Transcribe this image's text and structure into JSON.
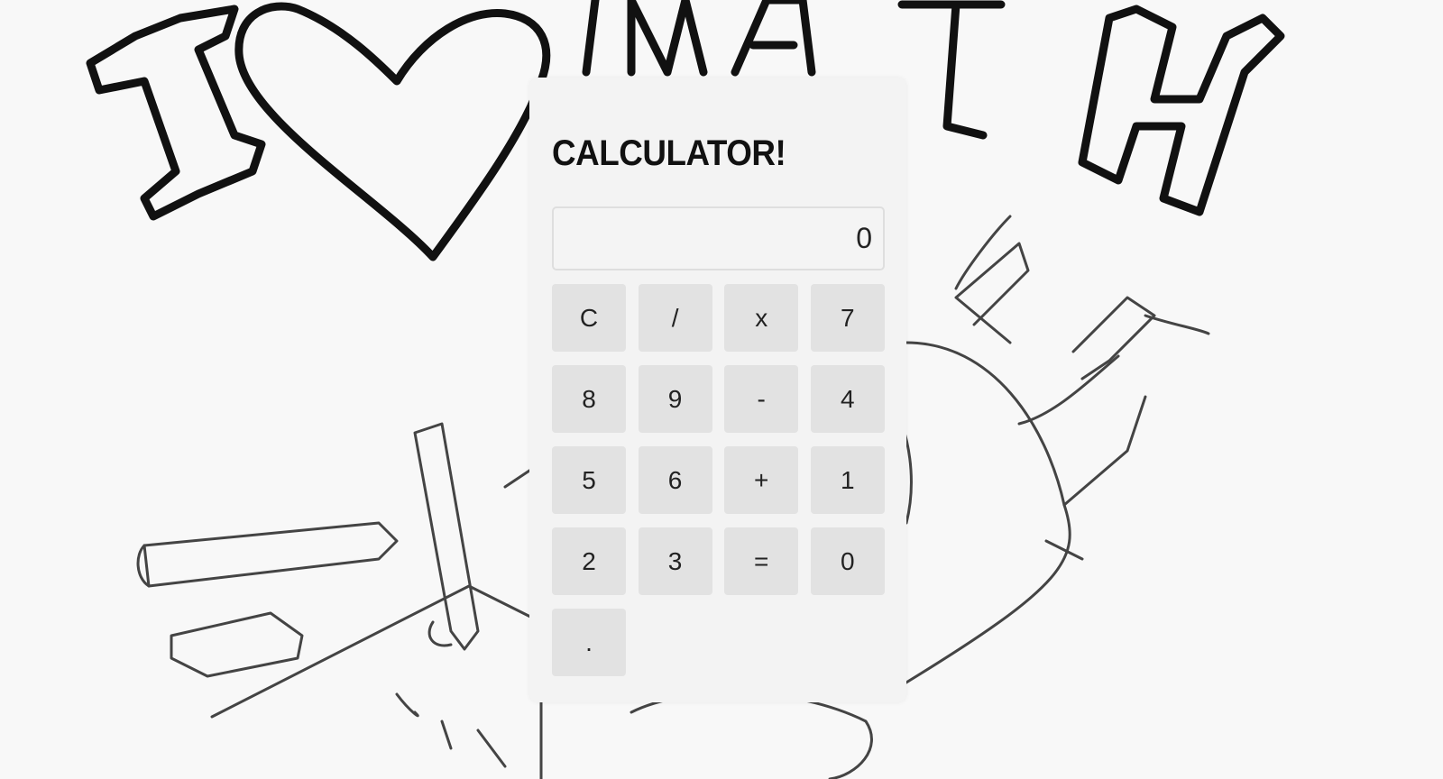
{
  "background": {
    "description_icon": "i-love-math-doodle"
  },
  "calculator": {
    "title": "CALCULATOR!",
    "display_value": "0",
    "keys": [
      "C",
      "/",
      "x",
      "7",
      "8",
      "9",
      "-",
      "4",
      "5",
      "6",
      "+",
      "1",
      "2",
      "3",
      "=",
      "0",
      "."
    ]
  },
  "colors": {
    "panel": "#f3f3f3",
    "key": "#e2e2e2",
    "text": "#111111"
  }
}
